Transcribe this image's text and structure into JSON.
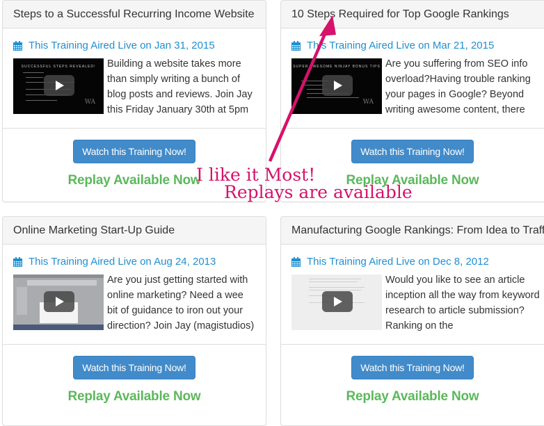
{
  "button_label": "Watch this Training Now!",
  "replay_label": "Replay Available Now",
  "cards": [
    {
      "title": "Steps to a Successful Recurring Income Website",
      "aired": "This Training Aired Live on Jan 31, 2015",
      "thumb_title": "SUCCESSFUL STEPS REVEALED!",
      "thumb_style": "dark",
      "description": "Building a website takes more than simply writing a bunch of blog posts and reviews. Join Jay this Friday January 30th at 5pm"
    },
    {
      "title": "10 Steps Required for Top Google Rankings",
      "aired": "This Training Aired Live on Mar 21, 2015",
      "thumb_title": "SUPER AWESOME NINJAY BONUS TIPS",
      "thumb_style": "dark",
      "description": "Are you suffering from SEO info overload?Having trouble ranking your pages in Google? Beyond writing awesome content, there"
    },
    {
      "title": "Online Marketing Start-Up Guide",
      "aired": "This Training Aired Live on Aug 24, 2013",
      "thumb_title": "",
      "thumb_style": "grey",
      "description": "Are you just getting started with online marketing? Need a wee bit of guidance to iron out your direction? Join Jay (magistudios)"
    },
    {
      "title": "Manufacturing Google Rankings: From Idea to Traffic",
      "aired": "This Training Aired Live on Dec 8, 2012",
      "thumb_title": "",
      "thumb_style": "light",
      "description": "Would you like to see an article inception all the way from keyword research to article submission?Ranking on the"
    }
  ],
  "annotation": {
    "line1": "I like it Most!",
    "line2": "Replays are available",
    "color": "#d6126b"
  },
  "colors": {
    "link_blue": "#1f8fd0",
    "button_blue": "#428bca",
    "replay_green": "#5cb85c"
  },
  "icons": {
    "calendar": "calendar-icon",
    "play": "play-icon"
  }
}
